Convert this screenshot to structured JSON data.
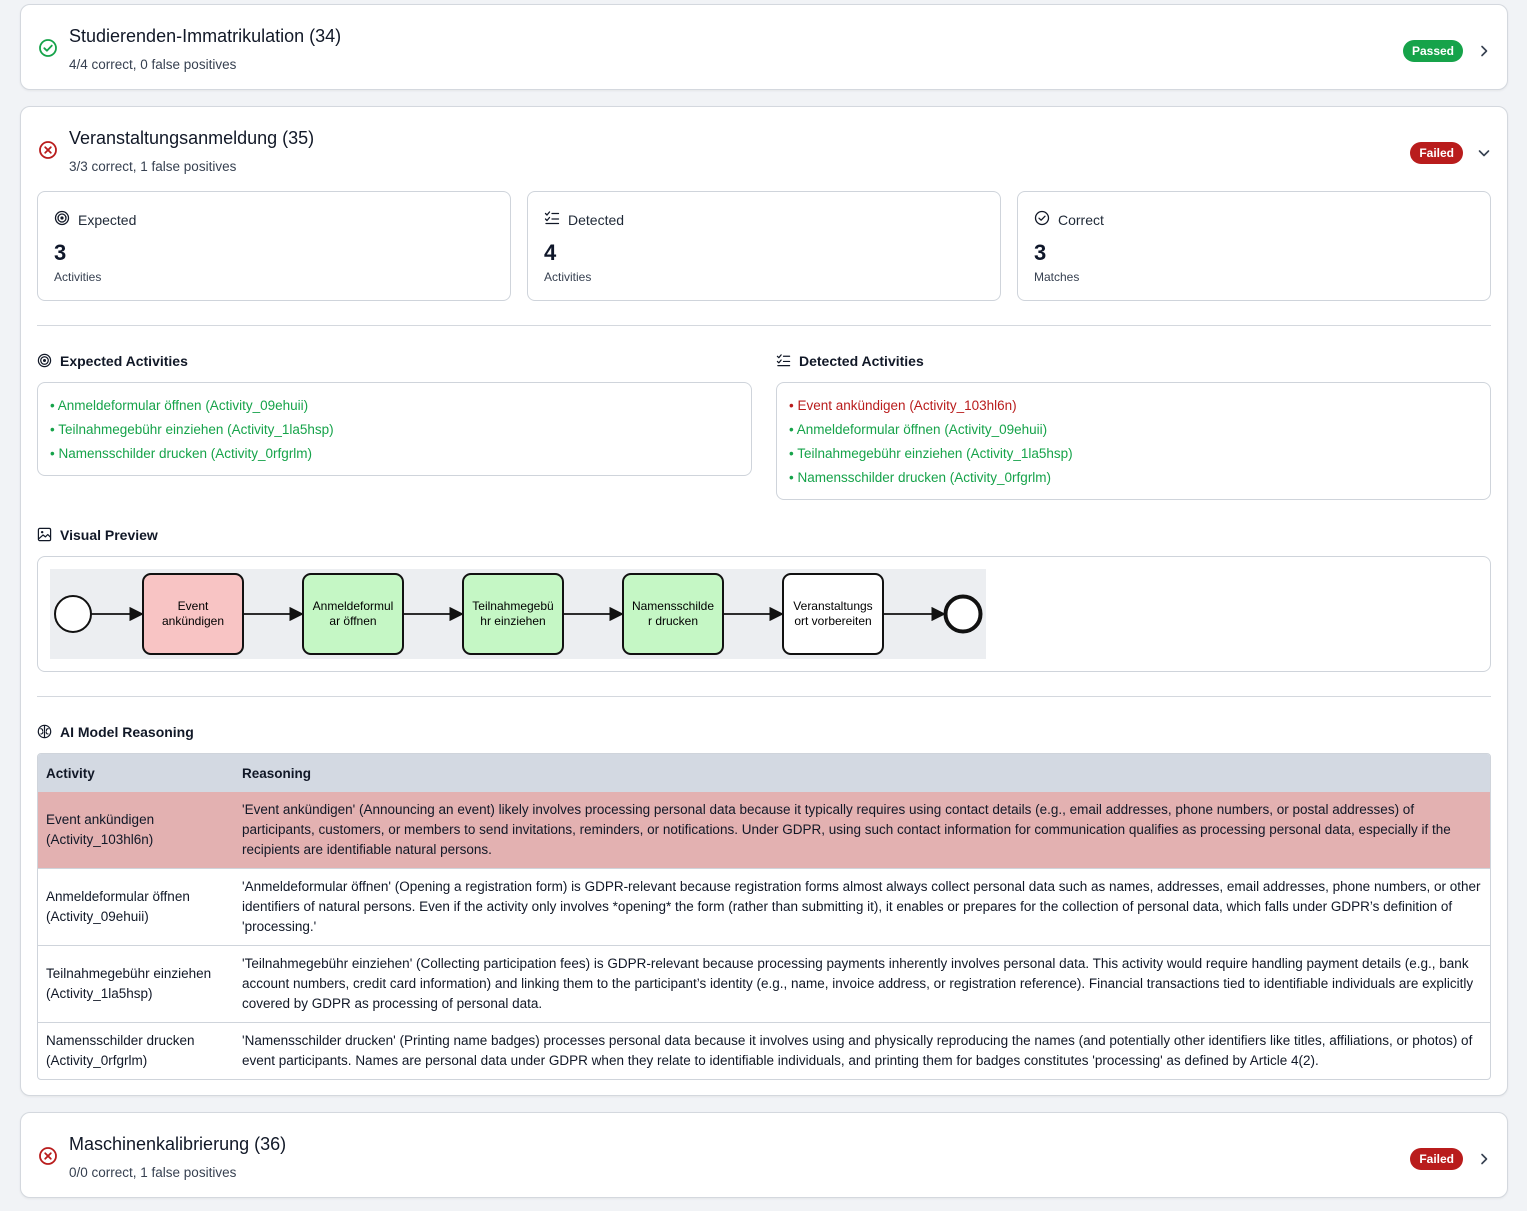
{
  "cards": {
    "top": {
      "title": "Studierenden-Immatrikulation (34)",
      "subtitle": "4/4 correct, 0 false positives",
      "status": "Passed"
    },
    "main": {
      "title": "Veranstaltungsanmeldung (35)",
      "subtitle": "3/3 correct, 1 false positives",
      "status": "Failed",
      "stats": [
        {
          "label": "Expected",
          "value": "3",
          "unit": "Activities",
          "icon": "target-icon"
        },
        {
          "label": "Detected",
          "value": "4",
          "unit": "Activities",
          "icon": "list-check-icon"
        },
        {
          "label": "Correct",
          "value": "3",
          "unit": "Matches",
          "icon": "check-circle-icon"
        }
      ],
      "expected_heading": "Expected Activities",
      "expected": [
        "• Anmeldeformular öffnen (Activity_09ehuii)",
        "• Teilnahmegebühr einziehen (Activity_1la5hsp)",
        "• Namensschilder drucken (Activity_0rfgrlm)"
      ],
      "detected_heading": "Detected Activities",
      "detected": [
        {
          "text": "• Event ankündigen (Activity_103hl6n)",
          "correct": false
        },
        {
          "text": "• Anmeldeformular öffnen (Activity_09ehuii)",
          "correct": true
        },
        {
          "text": "• Teilnahmegebühr einziehen (Activity_1la5hsp)",
          "correct": true
        },
        {
          "text": "• Namensschilder drucken (Activity_0rfgrlm)",
          "correct": true
        }
      ],
      "preview_heading": "Visual Preview",
      "diagram": [
        {
          "line1": "Event",
          "line2": "ankündigen",
          "state": "false-positive"
        },
        {
          "line1": "Anmeldeformul",
          "line2": "ar öffnen",
          "state": "match"
        },
        {
          "line1": "Teilnahmegebü",
          "line2": "hr einziehen",
          "state": "match"
        },
        {
          "line1": "Namensschilde",
          "line2": "r drucken",
          "state": "match"
        },
        {
          "line1": "Veranstaltungs",
          "line2": "ort vorbereiten",
          "state": "none"
        }
      ],
      "reasoning_heading": "AI Model Reasoning",
      "table": {
        "headers": [
          "Activity",
          "Reasoning"
        ],
        "rows": [
          {
            "activity": "Event ankündigen (Activity_103hl6n)",
            "reasoning": "'Event ankündigen' (Announcing an event) likely involves processing personal data because it typically requires using contact details (e.g., email addresses, phone numbers, or postal addresses) of participants, customers, or members to send invitations, reminders, or notifications. Under GDPR, using such contact information for communication qualifies as processing personal data, especially if the recipients are identifiable natural persons.",
            "flagged": true
          },
          {
            "activity": "Anmeldeformular öffnen (Activity_09ehuii)",
            "reasoning": "'Anmeldeformular öffnen' (Opening a registration form) is GDPR-relevant because registration forms almost always collect personal data such as names, addresses, email addresses, phone numbers, or other identifiers of natural persons. Even if the activity only involves *opening* the form (rather than submitting it), it enables or prepares for the collection of personal data, which falls under GDPR’s definition of 'processing.'",
            "flagged": false
          },
          {
            "activity": "Teilnahmegebühr einziehen (Activity_1la5hsp)",
            "reasoning": "'Teilnahmegebühr einziehen' (Collecting participation fees) is GDPR-relevant because processing payments inherently involves personal data. This activity would require handling payment details (e.g., bank account numbers, credit card information) and linking them to the participant’s identity (e.g., name, invoice address, or registration reference). Financial transactions tied to identifiable individuals are explicitly covered by GDPR as processing of personal data.",
            "flagged": false
          },
          {
            "activity": "Namensschilder drucken (Activity_0rfgrlm)",
            "reasoning": "'Namensschilder drucken' (Printing name badges) processes personal data because it involves using and physically reproducing the names (and potentially other identifiers like titles, affiliations, or photos) of event participants. Names are personal data under GDPR when they relate to identifiable individuals, and printing them for badges constitutes 'processing' as defined by Article 4(2).",
            "flagged": false
          }
        ]
      }
    },
    "bottom": {
      "title": "Maschinenkalibrierung (36)",
      "subtitle": "0/0 correct, 1 false positives",
      "status": "Failed"
    }
  },
  "colors": {
    "passed": "#16a34a",
    "failed": "#b91c1c",
    "match_fill": "#c5f7c5",
    "false_positive_fill": "#f8c4c4",
    "flag_row": "#e3b1b1"
  }
}
